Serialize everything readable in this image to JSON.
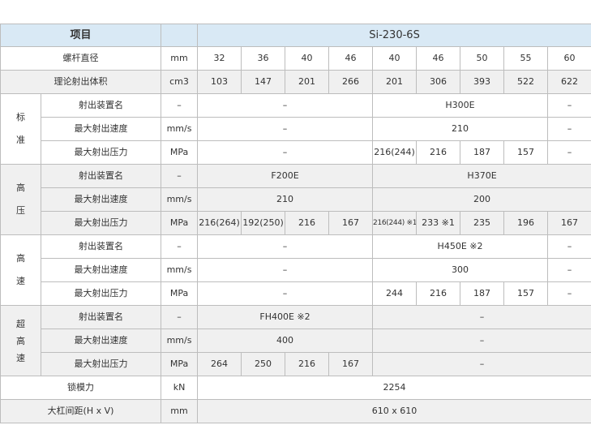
{
  "header": {
    "item": "项目",
    "model": "Si-230-6S"
  },
  "screw": {
    "label": "螺杆直径",
    "unit": "mm",
    "values": [
      "32",
      "36",
      "40",
      "46",
      "40",
      "46",
      "50",
      "55",
      "60"
    ]
  },
  "volume": {
    "label": "理论射出体积",
    "unit": "cm3",
    "values": [
      "103",
      "147",
      "201",
      "266",
      "201",
      "306",
      "393",
      "522",
      "622"
    ]
  },
  "row_labels": {
    "unit_name": "射出装置名",
    "speed": "最大射出速度",
    "pressure": "最大射出压力"
  },
  "units": {
    "dash": "–",
    "speed": "mm/s",
    "pressure": "MPa"
  },
  "standard": {
    "label_chars": [
      "标",
      "准"
    ],
    "unit_left": "–",
    "unit_mid": "H300E",
    "unit_right": "–",
    "speed_left": "–",
    "speed_mid": "210",
    "speed_right": "–",
    "pressure_left": "–",
    "pressure_values": [
      "216(244)",
      "216",
      "187",
      "157"
    ],
    "pressure_right": "–"
  },
  "high_pressure": {
    "label_chars": [
      "高",
      "压"
    ],
    "unit_left": "F200E",
    "unit_right": "H370E",
    "speed_left": "210",
    "speed_right": "200",
    "pressure_values": [
      "216(264)",
      "192(250)",
      "216",
      "167",
      "216(244) ※1",
      "233 ※1",
      "235",
      "196",
      "167"
    ]
  },
  "high_speed": {
    "label_chars": [
      "高",
      "速"
    ],
    "unit_left": "–",
    "unit_mid": "H450E ※2",
    "unit_right": "–",
    "speed_left": "–",
    "speed_mid": "300",
    "speed_right": "–",
    "pressure_left": "–",
    "pressure_values": [
      "244",
      "216",
      "187",
      "157"
    ],
    "pressure_right": "–"
  },
  "ultra_high_speed": {
    "label_chars": [
      "超",
      "高",
      "速"
    ],
    "unit_left": "FH400E ※2",
    "unit_right": "–",
    "speed_left": "400",
    "speed_right": "–",
    "pressure_values": [
      "264",
      "250",
      "216",
      "167"
    ],
    "pressure_right": "–"
  },
  "clamp": {
    "label": "锁模力",
    "unit": "kN",
    "value": "2254"
  },
  "tiebar": {
    "label": "大杠间距(H x V)",
    "unit": "mm",
    "value": "610 x 610"
  }
}
